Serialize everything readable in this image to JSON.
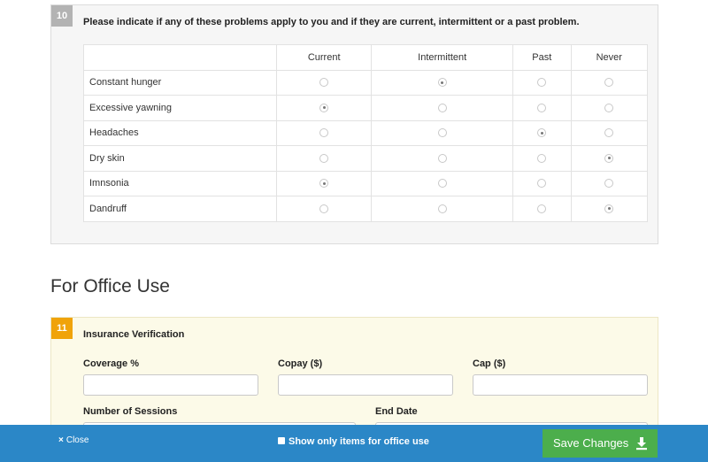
{
  "question10": {
    "number": "10",
    "prompt": "Please indicate if any of these problems apply to you and if they are current, intermittent or a past problem.",
    "columns": [
      "Current",
      "Intermittent",
      "Past",
      "Never"
    ],
    "rows": [
      {
        "label": "Constant hunger",
        "selected": "Intermittent"
      },
      {
        "label": "Excessive yawning",
        "selected": "Current"
      },
      {
        "label": "Headaches",
        "selected": "Past"
      },
      {
        "label": "Dry skin",
        "selected": "Never"
      },
      {
        "label": "Imnsonia",
        "selected": "Current"
      },
      {
        "label": "Dandruff",
        "selected": "Never"
      }
    ]
  },
  "office_section": {
    "heading": "For Office Use"
  },
  "question11": {
    "number": "11",
    "title": "Insurance Verification",
    "fields": {
      "coverage": {
        "label": "Coverage %",
        "value": ""
      },
      "copay": {
        "label": "Copay ($)",
        "value": ""
      },
      "cap": {
        "label": "Cap ($)",
        "value": ""
      },
      "sessions": {
        "label": "Number of Sessions",
        "value": ""
      },
      "end_date": {
        "label": "End Date",
        "value": ""
      }
    }
  },
  "footer": {
    "close_label": "Close",
    "close_icon": "×",
    "office_only_label": "Show only items for office use",
    "office_only_checked": false,
    "save_label": "Save Changes"
  },
  "colors": {
    "footer_bg": "#2b87c7",
    "save_bg": "#4cae4c",
    "q11_badge": "#f0a30a",
    "q10_badge": "#b3b3b3"
  }
}
